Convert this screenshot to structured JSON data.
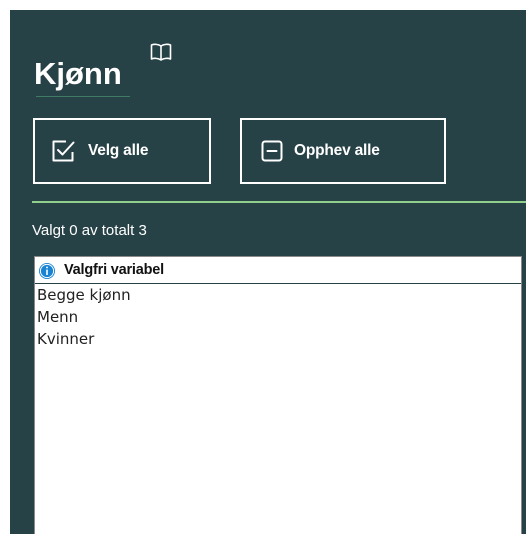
{
  "variable": {
    "title": "Kjønn",
    "info_icon": "book-open-icon"
  },
  "actions": {
    "select_all_label": "Velg alle",
    "select_all_icon": "checkbox-checked-icon",
    "deselect_all_label": "Opphev alle",
    "deselect_all_icon": "checkbox-minus-icon"
  },
  "selection": {
    "count_text": "Valgt 0 av totalt 3",
    "selected": 0,
    "total": 3
  },
  "list": {
    "header_label": "Valgfri variabel",
    "header_icon": "info-circle-icon",
    "options": [
      {
        "label": "Begge kjønn"
      },
      {
        "label": "Menn"
      },
      {
        "label": "Kvinner"
      }
    ]
  },
  "colors": {
    "panel_background": "#274247",
    "divider_accent": "#8fcf8a",
    "info_icon_blue": "#1a84d4"
  }
}
